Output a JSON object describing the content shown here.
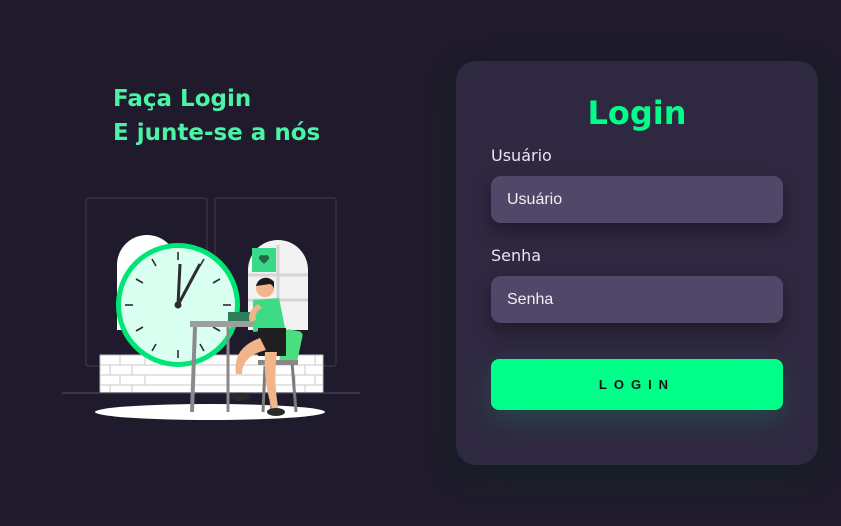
{
  "hero": {
    "line1": "Faça Login",
    "line2": "E junte-se a nós"
  },
  "login_form": {
    "title": "Login",
    "username_label": "Usuário",
    "username_placeholder": "Usuário",
    "password_label": "Senha",
    "password_placeholder": "Senha",
    "submit_label": "LOGIN"
  },
  "colors": {
    "background": "#201b2c",
    "card": "#2f2841",
    "input": "#514869",
    "accent": "#00ff88",
    "headline": "#4bf3a6"
  },
  "illustration": {
    "description_icon": "woman-at-desk-with-clock-illustration"
  }
}
